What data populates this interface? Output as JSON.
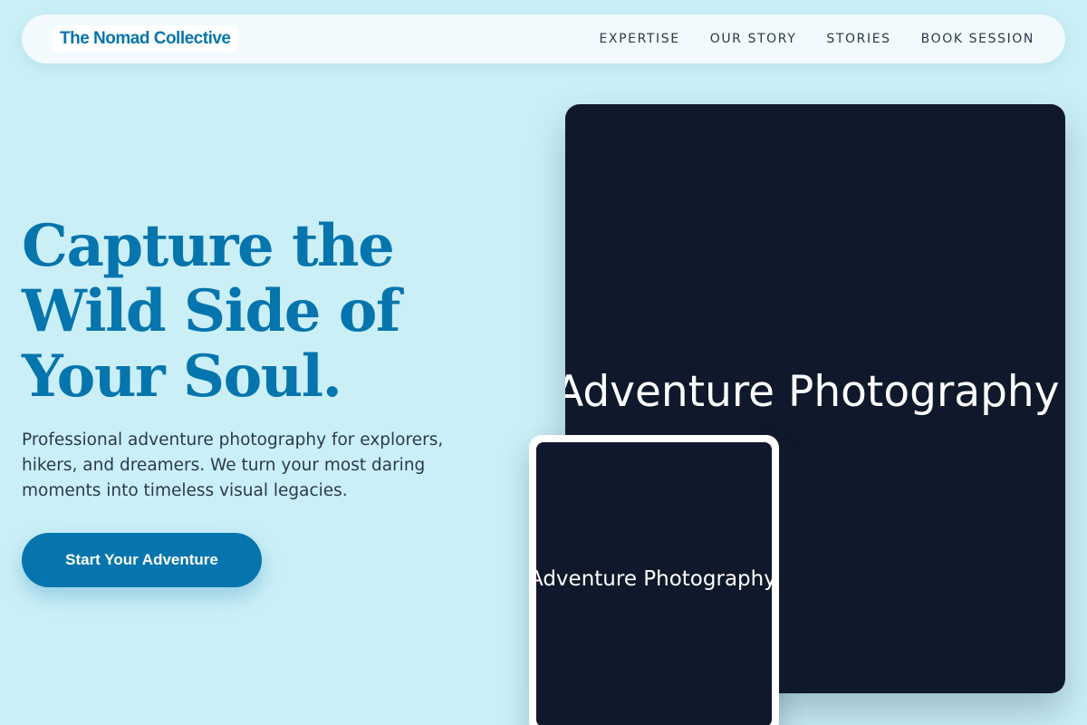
{
  "header": {
    "brand": "The Nomad Collective",
    "nav": [
      "EXPERTISE",
      "OUR STORY",
      "STORIES",
      "BOOK SESSION"
    ]
  },
  "hero": {
    "title_lines": [
      "Capture the",
      "Wild Side of",
      "Your Soul."
    ],
    "description": "Professional adventure photography for explorers, hikers, and dreamers. We turn your most daring moments into timeless visual legacies.",
    "cta_label": "Start Your Adventure"
  },
  "gallery": {
    "large_image_alt": "Adventure Photography",
    "small_image_alt": "Adventure Photography"
  },
  "colors": {
    "background": "#cbeff7",
    "accent": "#0675ad",
    "image_placeholder": "#10192b"
  }
}
